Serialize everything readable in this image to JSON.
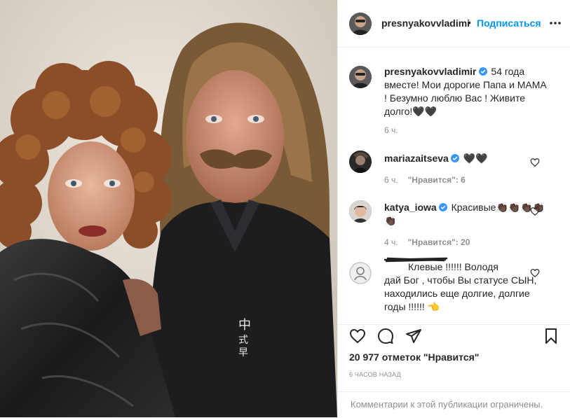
{
  "header": {
    "username": "presnyakovvladimi",
    "separator": "•",
    "follow_label": "Подписаться",
    "more_icon": "more-horizontal-icon"
  },
  "caption": {
    "username": "presnyakovvladimir",
    "text_line1": " 54 года",
    "text_line2": "вместе! Мои дорогие Папа и МАМА",
    "text_line3": "! Безумно люблю Вас ! Живите",
    "text_line4": "долго!🖤🖤",
    "time": "6 ч."
  },
  "comments": [
    {
      "username": "mariazaitseva",
      "verified": true,
      "text": " 🖤🖤",
      "time": "6 ч.",
      "likes": "\"Нравится\": 6"
    },
    {
      "username": "katya_iowa",
      "verified": true,
      "text_line1": " Красивые👏🏿👏🏿👏🏿👏🏿",
      "text_line2": "👏🏿",
      "time": "4 ч.",
      "likes": "\"Нравится\": 20"
    },
    {
      "username": "",
      "verified": false,
      "text_line1": "Клевые !!!!!! Володя",
      "text_line2": "дай Бог , чтобы Вы статусе СЫН,",
      "text_line3": "находились еще долгие, долгие",
      "text_line4": "годы !!!!!! 👈"
    }
  ],
  "actions": {
    "like_icon": "heart-icon",
    "comment_icon": "comment-icon",
    "share_icon": "paper-plane-icon",
    "save_icon": "bookmark-icon"
  },
  "likes_text": "20 977 отметок \"Нравится\"",
  "timestamp": "6 ЧАСОВ НАЗАД",
  "comments_closed": "Комментарии к этой публикации ограничены.",
  "colors": {
    "link_blue": "#0095f6",
    "verified_blue": "#3897f0",
    "secondary_text": "#8e8e8e",
    "divider": "#efefef"
  }
}
